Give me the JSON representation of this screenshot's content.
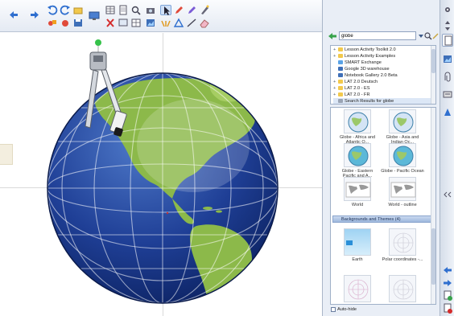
{
  "toolbar": {
    "buttons": [
      {
        "id": "back",
        "icon": "arrow-left-icon"
      },
      {
        "id": "forward",
        "icon": "arrow-right-icon"
      },
      {
        "id": "undo",
        "icon": "undo-icon"
      },
      {
        "id": "redo",
        "icon": "redo-icon"
      },
      {
        "id": "screen-shade",
        "icon": "screen-shade-icon"
      },
      {
        "id": "delete",
        "icon": "delete-x-icon"
      },
      {
        "id": "select",
        "icon": "pointer-icon"
      },
      {
        "id": "pen",
        "icon": "pen-icon"
      },
      {
        "id": "eraser",
        "icon": "eraser-icon"
      },
      {
        "id": "line",
        "icon": "line-icon"
      },
      {
        "id": "shape",
        "icon": "triangle-icon"
      },
      {
        "id": "fill",
        "icon": "fill-icon"
      }
    ]
  },
  "gallery": {
    "search_value": "globe",
    "tree_items": [
      {
        "label": "Lesson Activity Toolkit 2.0",
        "kind": "folder"
      },
      {
        "label": "Lesson Activity Examples",
        "kind": "folder"
      },
      {
        "label": "SMART Exchange",
        "kind": "web"
      },
      {
        "label": "Google 3D warehouse",
        "kind": "blue"
      },
      {
        "label": "Notebook Gallery 2.0 Beta",
        "kind": "blue"
      },
      {
        "label": "LAT 2.0 Deutsch",
        "kind": "folder"
      },
      {
        "label": "LAT 2.0 - ES",
        "kind": "folder"
      },
      {
        "label": "LAT 2.0 - FR",
        "kind": "folder"
      },
      {
        "label": "Search Results for globe",
        "kind": "search"
      }
    ],
    "thumbs": [
      {
        "label": "Globe - Africa and Atlantic O..."
      },
      {
        "label": "Globe - Asia and Indian Oc..."
      },
      {
        "label": "Globe - Eastern Pacific and A..."
      },
      {
        "label": "Globe - Pacific Ocean"
      },
      {
        "label": "World"
      },
      {
        "label": "World - outline"
      }
    ],
    "category": "Backgrounds and Themes (4)",
    "bg_thumbs": [
      {
        "label": "Earth"
      },
      {
        "label": "Polar coordinates -..."
      },
      {
        "label": ""
      },
      {
        "label": ""
      }
    ],
    "autohide_label": "Auto-hide"
  },
  "colors": {
    "ocean": "#1b3b8c",
    "land": "#8cb94a",
    "toolbar_bg": "#e4eaf3"
  }
}
